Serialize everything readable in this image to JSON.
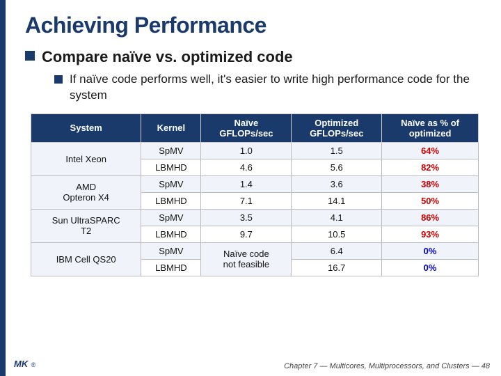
{
  "slide": {
    "title": "Achieving Performance",
    "bullet_main": "Compare naïve vs. optimized code",
    "bullet_sub": "If naïve code performs well, it's easier to write high performance code for the system",
    "table": {
      "headers": [
        "System",
        "Kernel",
        "Naïve GFLOPs/sec",
        "Optimized GFLOPs/sec",
        "Naïve as % of optimized"
      ],
      "rows": [
        {
          "system": "Intel Xeon",
          "kernel": "SpMV",
          "naive": "1.0",
          "optimized": "1.5",
          "percent": "64%",
          "pct_class": "pct-red",
          "rowspan": 2
        },
        {
          "system": "",
          "kernel": "LBMHD",
          "naive": "4.6",
          "optimized": "5.6",
          "percent": "82%",
          "pct_class": "pct-red",
          "rowspan": 0
        },
        {
          "system": "AMD Opteron X4",
          "kernel": "SpMV",
          "naive": "1.4",
          "optimized": "3.6",
          "percent": "38%",
          "pct_class": "pct-red",
          "rowspan": 2
        },
        {
          "system": "",
          "kernel": "LBMHD",
          "naive": "7.1",
          "optimized": "14.1",
          "percent": "50%",
          "pct_class": "pct-red",
          "rowspan": 0
        },
        {
          "system": "Sun UltraSPARC T2",
          "kernel": "SpMV",
          "naive": "3.5",
          "optimized": "4.1",
          "percent": "86%",
          "pct_class": "pct-red",
          "rowspan": 2
        },
        {
          "system": "",
          "kernel": "LBMHD",
          "naive": "9.7",
          "optimized": "10.5",
          "percent": "93%",
          "pct_class": "pct-red",
          "rowspan": 0
        },
        {
          "system": "IBM Cell QS20",
          "kernel": "SpMV",
          "naive": "Naïve code not feasible",
          "optimized": "6.4",
          "percent": "0%",
          "pct_class": "pct-blue",
          "rowspan": 2,
          "naive_special": true
        },
        {
          "system": "",
          "kernel": "LBMHD",
          "naive": "",
          "optimized": "16.7",
          "percent": "0%",
          "pct_class": "pct-blue",
          "rowspan": 0,
          "naive_empty": true
        }
      ]
    },
    "footer": "Chapter 7 — Multicores, Multiprocessors, and Clusters — 48",
    "logo": "MK"
  }
}
